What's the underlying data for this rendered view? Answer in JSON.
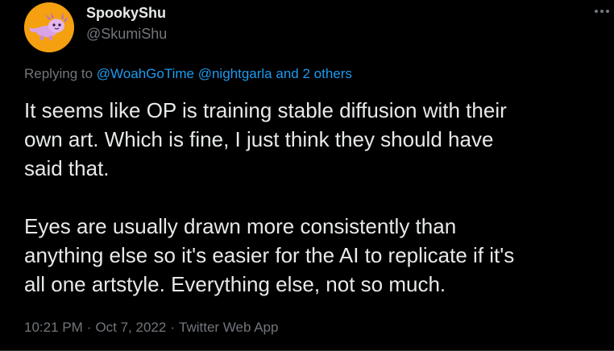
{
  "author": {
    "display_name": "SpookyShu",
    "handle": "@SkumiShu",
    "avatar_icon": "axolotl-avatar-icon",
    "avatar_bg": "#f4a011"
  },
  "menu": {
    "icon": "more-horizontal-icon"
  },
  "reply_context": {
    "prefix": "Replying to",
    "mention_1": "@WoahGoTime",
    "mention_2": "@nightgarla",
    "others": "and 2 others"
  },
  "tweet": {
    "lines": [
      "It seems like OP is training stable diffusion with their",
      "own art. Which is fine, I just think they should have",
      "said that.",
      "Eyes are usually drawn more consistently than",
      "anything else so it's easier for the AI to replicate if it's",
      "all one artstyle. Everything else, not so much."
    ]
  },
  "meta": {
    "time": "10:21 PM",
    "separator": "·",
    "date": "Oct 7, 2022",
    "source": "Twitter Web App"
  },
  "colors": {
    "background": "#000000",
    "text": "#e7e9ea",
    "muted": "#71767b",
    "link": "#1d9bf0"
  }
}
